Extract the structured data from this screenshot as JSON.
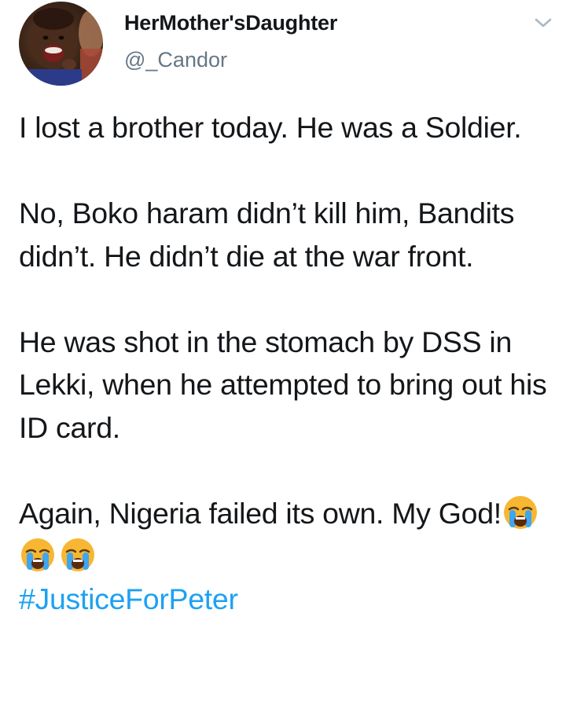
{
  "user": {
    "display_name": "HerMother'sDaughter",
    "handle": "@_Candor",
    "avatar_icon": "child-avatar-icon"
  },
  "menu": {
    "icon": "chevron-down-icon",
    "color": "#aab8c2"
  },
  "tweet": {
    "paragraphs": [
      "I lost a brother today. He was a Soldier.",
      "No, Boko haram didn’t kill him, Bandits didn’t. He didn’t die at the war front.",
      "He was shot in the stomach by DSS in Lekki, when he attempted to bring out his ID card."
    ],
    "last_paragraph_text": "Again, Nigeria failed its own. My God!",
    "emojis": [
      "loudly-crying-face-icon",
      "loudly-crying-face-icon",
      "loudly-crying-face-icon"
    ],
    "hashtag": "#JusticeForPeter"
  },
  "colors": {
    "text": "#14171a",
    "secondary": "#657786",
    "link": "#1da1f2"
  }
}
